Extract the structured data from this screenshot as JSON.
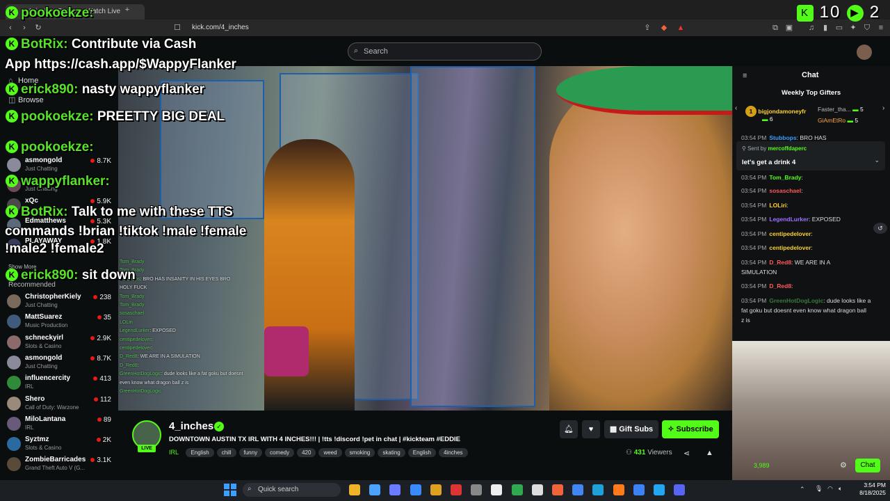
{
  "browser": {
    "tab_title": "4_inches Stream - Watch Live",
    "url": "kick.com/4_inches"
  },
  "site": {
    "search_placeholder": "Search"
  },
  "sidebar": {
    "nav": [
      {
        "label": "Home",
        "icon": "home-icon"
      },
      {
        "label": "Browse",
        "icon": "browse-icon"
      }
    ],
    "following": [
      {
        "name": "asmongold",
        "category": "Just Chatting",
        "viewers": "8.7K"
      },
      {
        "name": "las",
        "category": "Just Chatting",
        "viewers": ""
      },
      {
        "name": "xQc",
        "category": "",
        "viewers": "5.9K"
      },
      {
        "name": "Edmatthews",
        "category": "",
        "viewers": "5.3K"
      },
      {
        "name": "PLAYAWAY",
        "category": "",
        "viewers": "1.8K"
      }
    ],
    "show_more": "Show More",
    "recommended_label": "Recommended",
    "recommended": [
      {
        "name": "ChristopherKiely",
        "category": "Just Chatting",
        "viewers": "238",
        "color": "#7a6a5c"
      },
      {
        "name": "MattSuarez",
        "category": "Music Production",
        "viewers": "35",
        "color": "#3f5a7a"
      },
      {
        "name": "schneckyirl",
        "category": "Slots & Casino",
        "viewers": "2.9K",
        "color": "#8a6a6a"
      },
      {
        "name": "asmongold",
        "category": "Just Chatting",
        "viewers": "8.7K",
        "color": "#8a8a9a"
      },
      {
        "name": "influencercity",
        "category": "IRL",
        "viewers": "413",
        "color": "#2f8a3a"
      },
      {
        "name": "Shero",
        "category": "Call of Duty: Warzone",
        "viewers": "112",
        "color": "#9a8a7a"
      },
      {
        "name": "MiloLantana",
        "category": "IRL",
        "viewers": "89",
        "color": "#6a5a7a"
      },
      {
        "name": "Syztmz",
        "category": "Slots & Casino",
        "viewers": "2K",
        "color": "#2a6aa0"
      },
      {
        "name": "ZombieBarricades",
        "category": "Grand Theft Auto V (G...",
        "viewers": "3.1K",
        "color": "#5a4a3a"
      }
    ]
  },
  "stream": {
    "streamer": "4_inches",
    "live": "LIVE",
    "title": "DOWNTOWN AUSTIN TX IRL WITH 4 INCHES!!! | !tts !discord !pet in chat | #kickteam #EDDIE",
    "category": "IRL",
    "tags": [
      "English",
      "chill",
      "funny",
      "comedy",
      "420",
      "weed",
      "smoking",
      "skating",
      "English",
      "4inches"
    ],
    "gift_subs": "Gift Subs",
    "subscribe": "Subscribe",
    "viewers": "431",
    "viewers_label": "Viewers"
  },
  "video_chat": [
    {
      "user": "Tom_Brady",
      "text": ""
    },
    {
      "user": "Tom_Brady",
      "text": ""
    },
    {
      "user": "Stubbops",
      "text": ": BRO HAS INSANITY IN HIS EYES BRO"
    },
    {
      "user": "",
      "text": "HOLY FUCK"
    },
    {
      "user": "Tom_Brady",
      "text": ""
    },
    {
      "user": "Tom_Brady",
      "text": ""
    },
    {
      "user": "sosaschael",
      "text": ""
    },
    {
      "user": "LOLiri",
      "text": ""
    },
    {
      "user": "LegendLurker",
      "text": ": EXPOSED"
    },
    {
      "user": "centipedelover",
      "text": ":"
    },
    {
      "user": "centipedelover",
      "text": ":"
    },
    {
      "user": "D_Red8",
      "text": ": WE ARE IN A SIMULATION"
    },
    {
      "user": "D_Red8",
      "text": ":"
    },
    {
      "user": "GreenHotDogLogic",
      "text": ": dude looks like a fat goku but doesnt"
    },
    {
      "user": "",
      "text": "even know what dragon ball z is"
    },
    {
      "user": "GreenHotDogLogic",
      "text": ""
    }
  ],
  "chat": {
    "title": "Chat",
    "gifters_title": "Weekly Top Gifters",
    "gifters": [
      {
        "rank": "1",
        "name": "bigjondamoneyfr",
        "count": "6"
      },
      {
        "rank": "",
        "name": "Faster_tha...",
        "count": "5"
      },
      {
        "rank": "",
        "name": "GiAmEtRo",
        "count": "5"
      }
    ],
    "pinned_sender_label": "Sent by",
    "pinned_sender": "mercoffdaperc",
    "pinned_text": "let's get a drink 4",
    "messages": [
      {
        "time": "03:54 PM",
        "user": "Stubbops",
        "text": ": BRO HAS",
        "color": "#3aa0ff"
      },
      {
        "time": "03:54 PM",
        "user": "Tom_Brady",
        "text": ":",
        "color": "#53fc18"
      },
      {
        "time": "03:54 PM",
        "user": "sosaschael",
        "text": ":",
        "color": "#ff5a5a"
      },
      {
        "time": "03:54 PM",
        "user": "LOLiri",
        "text": ":",
        "color": "#ffd230"
      },
      {
        "time": "03:54 PM",
        "user": "LegendLurker",
        "text": ": EXPOSED",
        "color": "#a070ff"
      },
      {
        "time": "03:54 PM",
        "user": "centipedelover",
        "text": ":",
        "color": "#ffd230"
      },
      {
        "time": "03:54 PM",
        "user": "centipedelover",
        "text": ":",
        "color": "#ffd230"
      },
      {
        "time": "03:54 PM",
        "user": "D_Red8",
        "text": ": WE ARE IN A",
        "color": "#ff5a5a"
      },
      {
        "time": "",
        "user": "",
        "text": "SIMULATION",
        "color": "#ddd"
      },
      {
        "time": "03:54 PM",
        "user": "D_Red8",
        "text": ":",
        "color": "#ff5a5a"
      },
      {
        "time": "03:54 PM",
        "user": "GreenHotDogLogic",
        "text": ": dude looks like a",
        "color": "#3a7a3a"
      },
      {
        "time": "",
        "user": "",
        "text": "fat goku but doesnt even know what dragon ball",
        "color": "#ddd"
      },
      {
        "time": "",
        "user": "",
        "text": "z is",
        "color": "#ddd"
      }
    ],
    "points": "3,989",
    "send_label": "Chat"
  },
  "overlay": {
    "score": "10",
    "score2": "2",
    "messages": [
      {
        "user": "pookoekze:",
        "text": ""
      },
      {
        "user": "BotRix:",
        "text": "Contribute via Cash"
      },
      {
        "user": "",
        "text": "App https://cash.app/$WappyFlanker"
      },
      {
        "user": "erick890:",
        "text": "nasty wappyflanker"
      },
      {
        "user": "pookoekze:",
        "text": "PREETTY BIG DEAL"
      },
      {
        "user": "pookoekze:",
        "text": ""
      },
      {
        "user": "wappyflanker:",
        "text": ""
      },
      {
        "user": "BotRix:",
        "text": "Talk to me with these TTS"
      },
      {
        "user": "",
        "text": "commands !brian !tiktok !male !female"
      },
      {
        "user": "",
        "text": "!male2 !female2"
      },
      {
        "user": "erick890:",
        "text": "sit down"
      }
    ]
  },
  "taskbar": {
    "search_placeholder": "Quick search",
    "time": "3:54 PM",
    "date": "8/18/2025"
  },
  "colors": {
    "brand": "#53fc18",
    "live": "#e91916"
  }
}
